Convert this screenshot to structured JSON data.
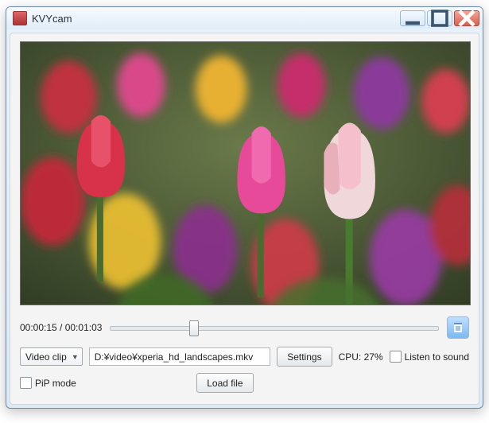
{
  "window": {
    "title": "KVYcam"
  },
  "timeline": {
    "time_text": "00:00:15 / 00:01:03",
    "position_percent": 24
  },
  "source": {
    "dropdown_label": "Video clip",
    "file_path": "D:¥video¥xperia_hd_landscapes.mkv"
  },
  "buttons": {
    "settings": "Settings",
    "load_file": "Load file"
  },
  "status": {
    "cpu_label": "CPU: 27%"
  },
  "checkboxes": {
    "listen_to_sound": "Listen to sound",
    "pip_mode": "PiP mode"
  }
}
